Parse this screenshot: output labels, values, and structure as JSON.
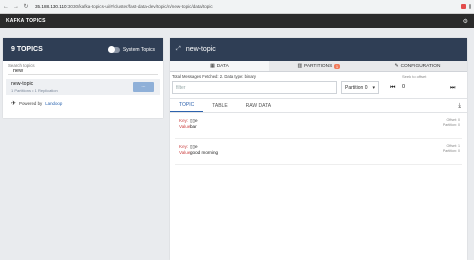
{
  "browser": {
    "url_host": "35.188.130.110",
    "url_path": ":3030/kafka-topics-ui/#/cluster/fast-data-dev/topic/n/new-topic/data/topic"
  },
  "app": {
    "title": "KAFKA TOPICS"
  },
  "left": {
    "topics_count": "9 TOPICS",
    "system_topics_label": "System Topics",
    "search_label": "Search topics",
    "search_value": "new",
    "topic": {
      "name": "new-topic",
      "meta": "1 Partitions • 1 Replication",
      "button": "..."
    },
    "powered_by": "Powered by",
    "powered_link": "Landoop"
  },
  "right": {
    "topic_name": "new-topic",
    "tabs": [
      {
        "label": "DATA",
        "icon": "table-icon"
      },
      {
        "label": "PARTITIONS",
        "icon": "columns-icon",
        "badge": "1"
      },
      {
        "label": "CONFIGURATION",
        "icon": "wrench-icon"
      }
    ],
    "meta": "Total Messages Fetched: 2. Data type: binary",
    "filter_placeholder": "filter",
    "partition": "Partition 0",
    "offset_label": "Seek to offset",
    "offset_value": "0",
    "subtabs": [
      "TOPIC",
      "TABLE",
      "RAW DATA"
    ],
    "messages": [
      {
        "key_label": "Key:",
        "key": "▯▯e",
        "value_label": "Value:",
        "value": "bar",
        "offset": "Offset: 0",
        "partition": "Partition: 0"
      },
      {
        "key_label": "Key:",
        "key": "▯▯e",
        "value_label": "Value:",
        "value": "good morning",
        "offset": "Offset: 1",
        "partition": "Partition: 0"
      }
    ]
  },
  "colors": {
    "app_bar": "#2b2b2b",
    "panel_header": "#2f3e55",
    "accent": "#2d62ad",
    "badge": "#f07a5a"
  }
}
